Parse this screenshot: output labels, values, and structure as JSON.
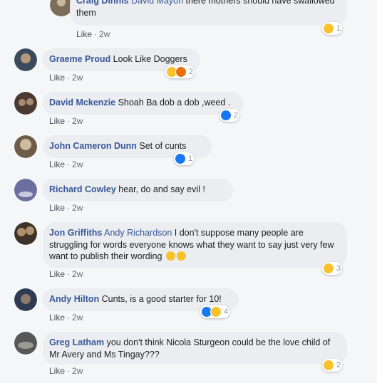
{
  "comments": [
    {
      "author": "Craig Dinnis",
      "mention": "David Mayoh",
      "text": " there mothers should have swallowed them",
      "like_label": "Like",
      "time": "2w",
      "reaction_count": "1",
      "avatar_colors": [
        "#7a6d5a",
        "#c9b79b"
      ]
    },
    {
      "author": "Graeme Proud",
      "text": " Look Like Doggers",
      "like_label": "Like",
      "time": "2w",
      "reaction_count": "2",
      "avatar_colors": [
        "#3c4a5e",
        "#b59a7a"
      ]
    },
    {
      "author": "David Mckenzie",
      "text": " Shoah Ba dob a dob ,weed .",
      "like_label": "Like",
      "time": "2w",
      "reaction_count": "2",
      "avatar_colors": [
        "#4a3a32",
        "#a88c72"
      ]
    },
    {
      "author": "John Cameron Dunn",
      "text": " Set of cunts",
      "like_label": "Like",
      "time": "2w",
      "reaction_count": "1",
      "avatar_colors": [
        "#6d5c47",
        "#cdbb9f"
      ]
    },
    {
      "author": "Richard Cowley",
      "text": " hear, do and say evil !",
      "like_label": "Like",
      "time": "2w",
      "avatar_colors": [
        "#6a6fa0",
        "#c7c9dd"
      ]
    },
    {
      "author": "Jon Griffiths",
      "mention": "Andy Richardson",
      "text": " I don't suppose many people are struggling for words everyone knows what they want to say just very few want to publish their wording",
      "like_label": "Like",
      "time": "2w",
      "reaction_count": "3",
      "avatar_colors": [
        "#3d3328",
        "#b08f6c"
      ]
    },
    {
      "author": "Andy Hilton",
      "text": " Cunts, is a good starter for 10!",
      "like_label": "Like",
      "time": "2w",
      "reaction_count": "4",
      "avatar_colors": [
        "#2f3b52",
        "#8d7c6a"
      ]
    },
    {
      "author": "Greg Latham",
      "text": " you don't think Nicola Sturgeon could be the love child of Mr Avery and Ms Tingay???",
      "like_label": "Like",
      "time": "2w",
      "reaction_count": "2",
      "avatar_colors": [
        "#575757",
        "#9d9a93"
      ]
    }
  ],
  "colors": {
    "link": "#385898",
    "bubble": "#ebedf0",
    "background": "#f5f6f7",
    "haha": "#f7c22c",
    "angry": "#e9710f",
    "like": "#1877f2"
  },
  "icons": [
    "haha-emoji-icon",
    "angry-emoji-icon",
    "like-thumb-icon",
    "confused-emoji-icon",
    "laughing-emoji-icon"
  ]
}
